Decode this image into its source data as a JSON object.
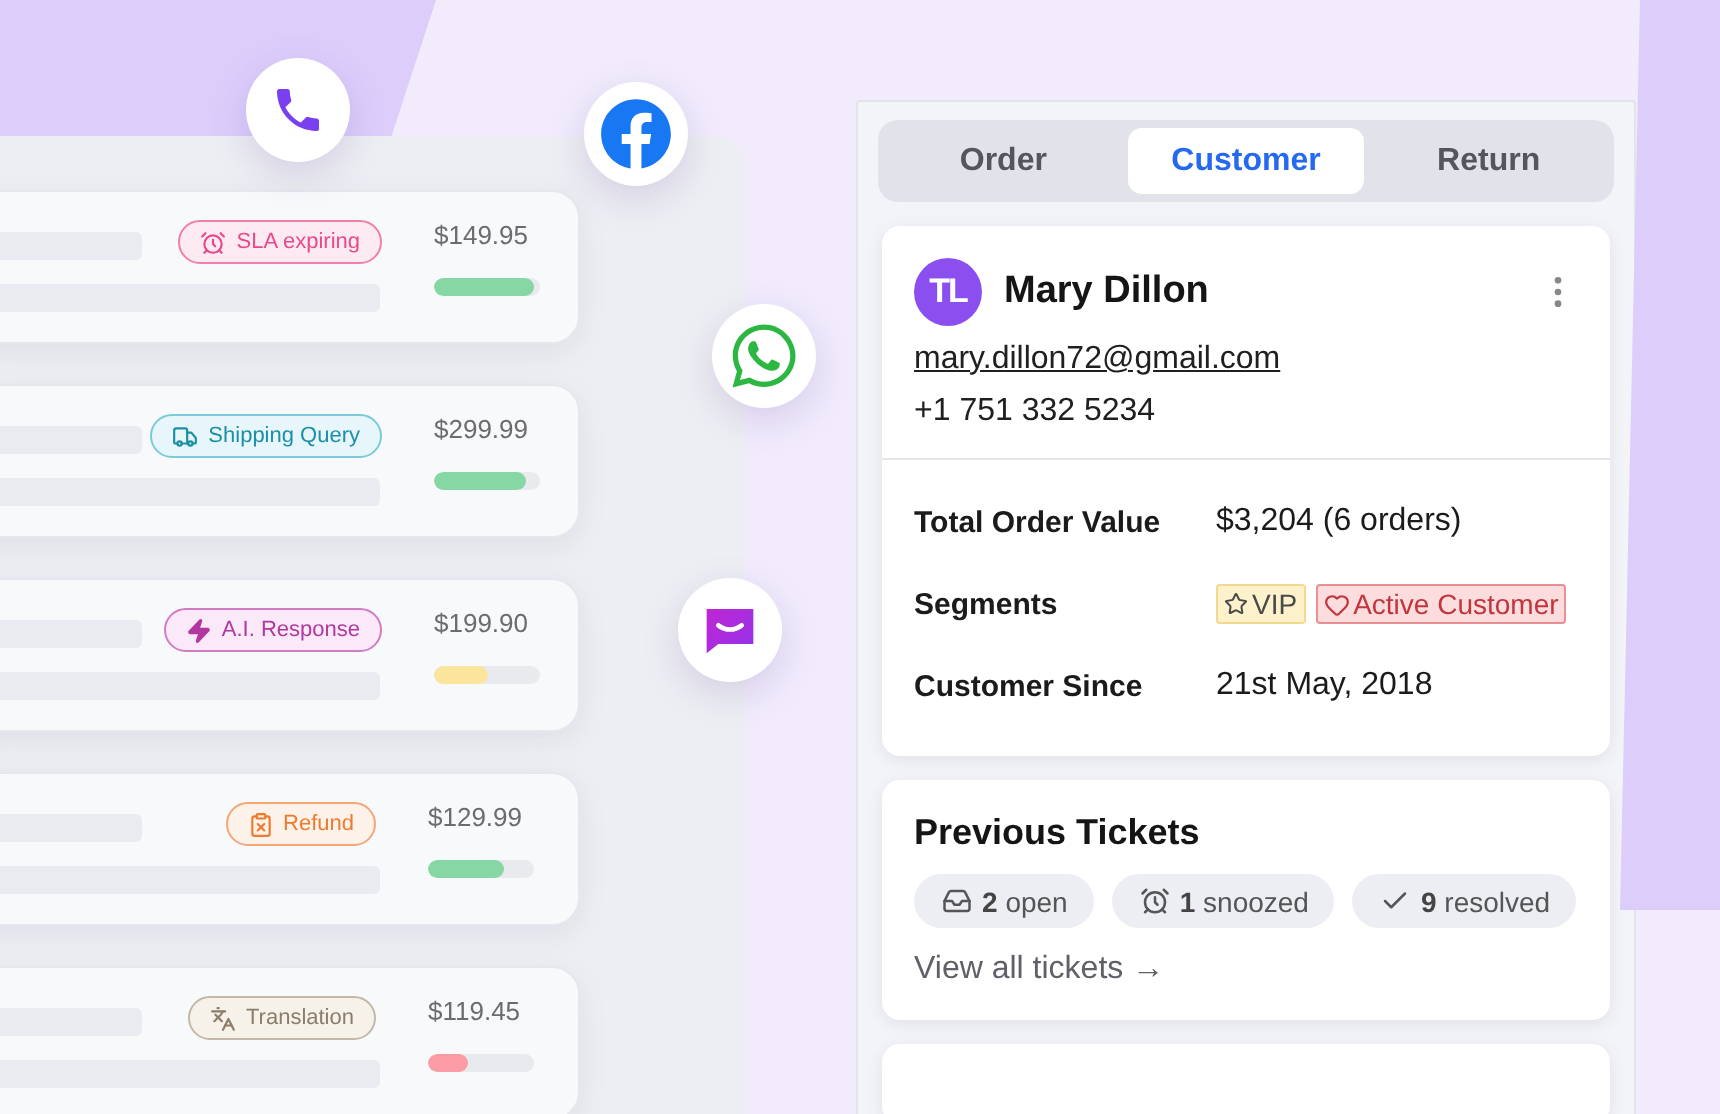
{
  "tickets": [
    {
      "tag": {
        "kind": "sla",
        "label": "SLA expiring"
      },
      "price": "$149.95",
      "level": 0.94,
      "color": "#86d7a4"
    },
    {
      "tag": {
        "kind": "shipping",
        "label": "Shipping Query"
      },
      "price": "$299.99",
      "level": 0.87,
      "color": "#86d7a4"
    },
    {
      "tag": {
        "kind": "ai",
        "label": "A.I. Response"
      },
      "price": "$199.90",
      "level": 0.5,
      "color": "#fbe59c"
    },
    {
      "tag": {
        "kind": "refund",
        "label": "Refund"
      },
      "price": "$129.99",
      "level": 0.72,
      "color": "#86d7a4"
    },
    {
      "tag": {
        "kind": "translation",
        "label": "Translation"
      },
      "price": "$119.45",
      "level": 0.37,
      "color": "#fb9ca4"
    }
  ],
  "channels": [
    {
      "kind": "phone"
    },
    {
      "kind": "facebook"
    },
    {
      "kind": "whatsapp"
    },
    {
      "kind": "chat"
    }
  ],
  "tabs": [
    {
      "label": "Order",
      "selected": false
    },
    {
      "label": "Customer",
      "selected": true
    },
    {
      "label": "Return",
      "selected": false
    }
  ],
  "customer": {
    "initials": "TL",
    "name": "Mary Dillon",
    "email": "mary.dillon72@gmail.com",
    "phone": "+1 751 332 5234",
    "details": [
      {
        "label": "Total Order Value",
        "value": "$3,204 (6 orders)"
      },
      {
        "label": "Segments",
        "segments": [
          {
            "kind": "vip",
            "label": "VIP"
          },
          {
            "kind": "active",
            "label": "Active Customer"
          }
        ]
      },
      {
        "label": "Customer Since",
        "value": "21st May, 2018"
      }
    ]
  },
  "previous_tickets": {
    "title": "Previous Tickets",
    "chips": [
      {
        "kind": "open",
        "count": "2",
        "label": "open"
      },
      {
        "kind": "snoozed",
        "count": "1",
        "label": "snoozed"
      },
      {
        "kind": "resolved",
        "count": "9",
        "label": "resolved"
      }
    ],
    "link": "View all tickets →"
  }
}
